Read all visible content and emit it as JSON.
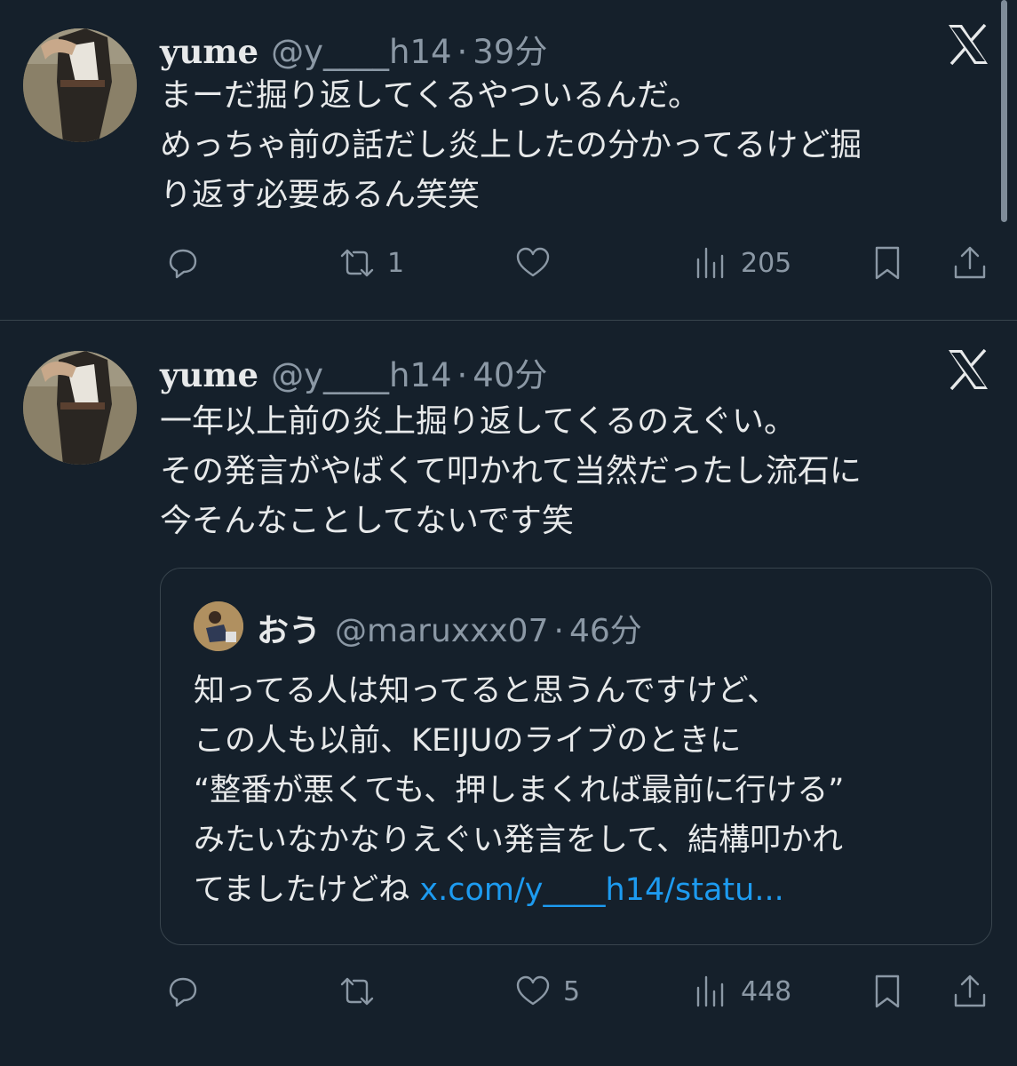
{
  "tweets": [
    {
      "name": "yume",
      "handle": "@y____h14",
      "separator": "·",
      "time": "39分",
      "lines": [
        "まーだ掘り返してくるやついるんだ。",
        "めっちゃ前の話だし炎上したの分かってるけど掘",
        "り返す必要あるん笑笑"
      ],
      "retweets": "1",
      "likes": "",
      "views": "205"
    },
    {
      "name": "yume",
      "handle": "@y____h14",
      "separator": "·",
      "time": "40分",
      "lines": [
        "一年以上前の炎上掘り返してくるのえぐい。",
        "その発言がやばくて叩かれて当然だったし流石に",
        "今そんなことしてないです笑"
      ],
      "retweets": "",
      "likes": "5",
      "views": "448",
      "quote": {
        "name": "おう",
        "handle": "@maruxxx07",
        "separator": "·",
        "time": "46分",
        "lines": [
          "知ってる人は知ってると思うんですけど、",
          "この人も以前、KEIJUのライブのときに",
          "“整番が悪くても、押しまくれば最前に行ける”",
          "みたいなかなりえぐい発言をして、結構叩かれ"
        ],
        "last_line": "てましたけどね",
        "link": "x.com/y____h14/statu..."
      }
    }
  ],
  "icons": {
    "logo": "x-logo-icon",
    "reply": "reply-icon",
    "retweet": "retweet-icon",
    "like": "heart-icon",
    "views": "views-icon",
    "bookmark": "bookmark-icon",
    "share": "share-icon"
  },
  "colors": {
    "background": "#15202b",
    "text": "#e7e9ea",
    "secondary": "#8b98a5",
    "link": "#1d9bf0",
    "border": "#38444d"
  }
}
